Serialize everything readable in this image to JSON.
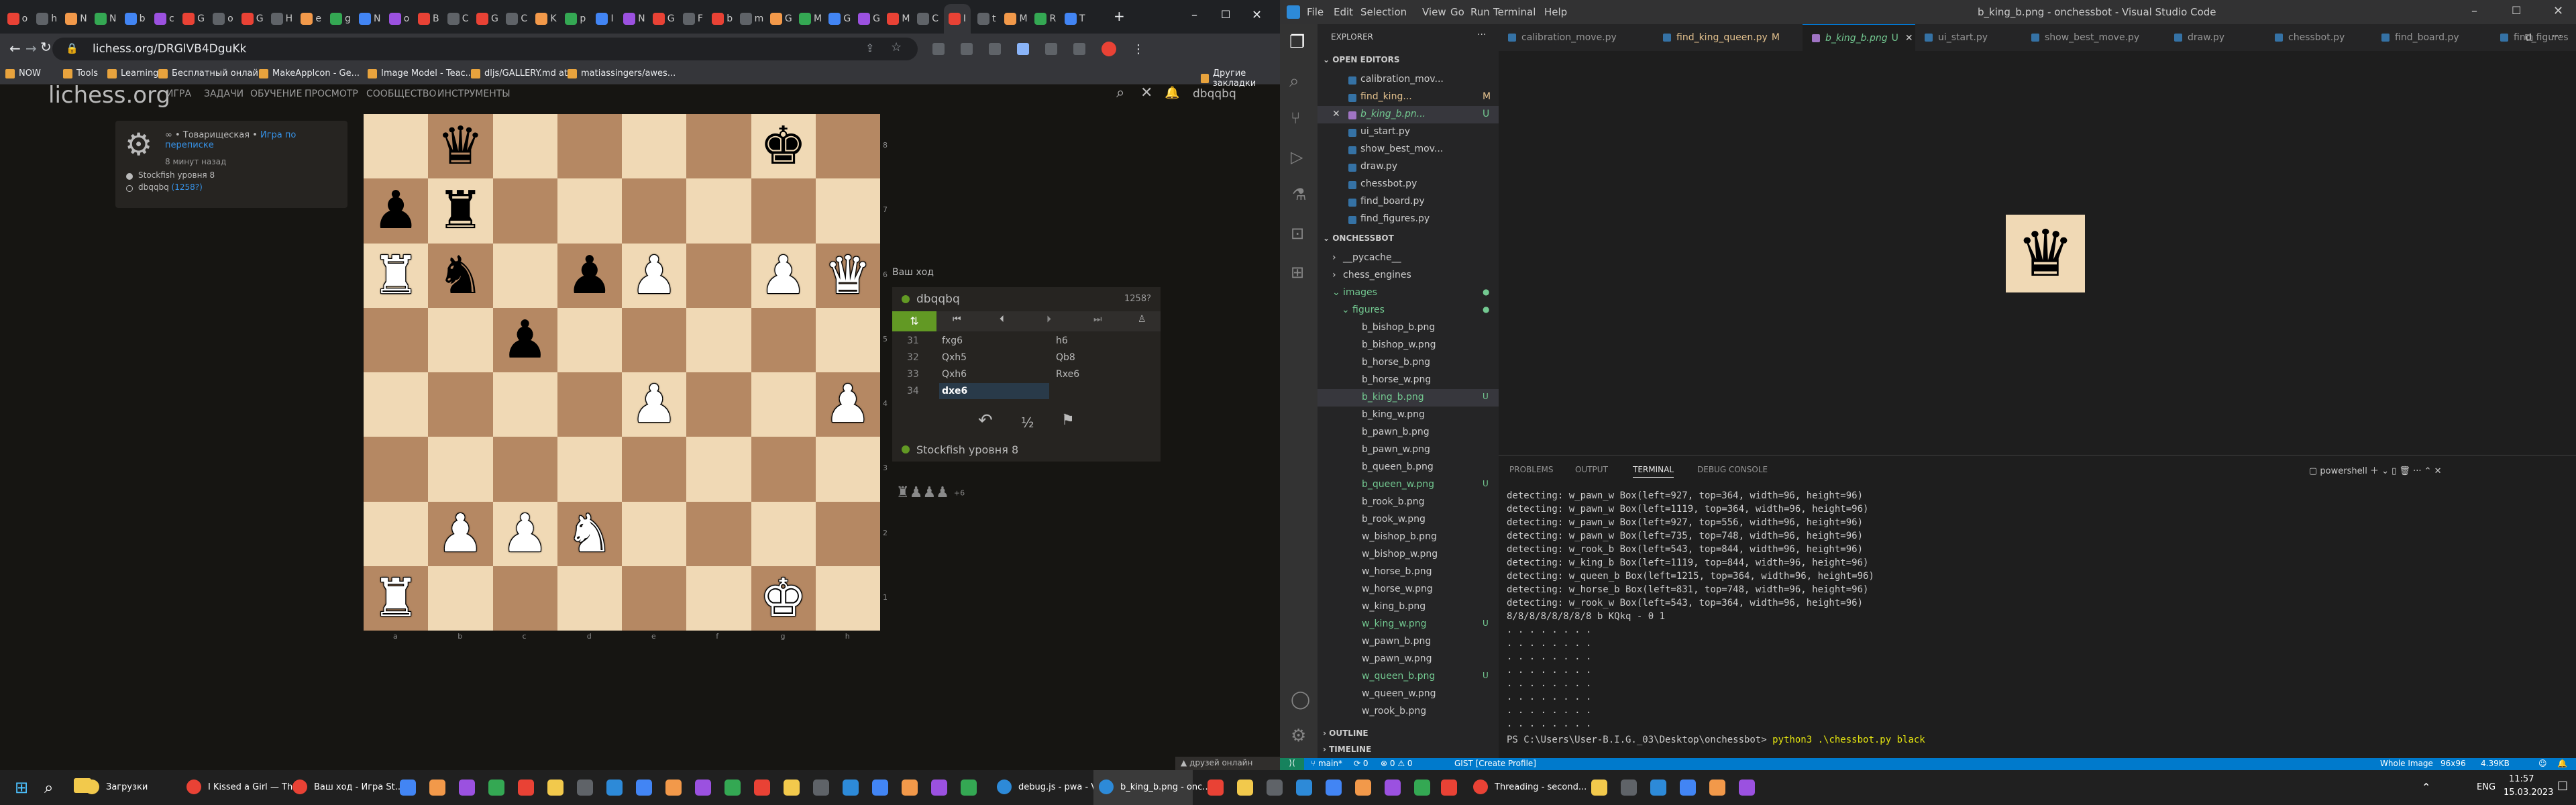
{
  "browser": {
    "url": "lichess.org/DRGlVB4DguKk",
    "tab_labels": [
      "o",
      "h",
      "N",
      "N",
      "b",
      "c",
      "G",
      "o",
      "G",
      "H",
      "e",
      "g",
      "N",
      "o",
      "B",
      "C",
      "G",
      "C",
      "K",
      "p",
      "I",
      "N",
      "G",
      "F",
      "b",
      "m",
      "G",
      "M",
      "G",
      "G",
      "M",
      "C",
      "I",
      "t",
      "M",
      "R",
      "T"
    ],
    "bookmarks": [
      "NOW",
      "Tools",
      "Learning",
      "Бесплатный онлайн",
      "MakeApplcon - Ge...",
      "Image Model - Teac...",
      "dljs/GALLERY.md at...",
      "matiassingers/awes..."
    ],
    "other_bookmarks": "Другие закладки"
  },
  "lichess": {
    "logo": "lichess.org",
    "nav": [
      "ИГРА",
      "ЗАДАЧИ",
      "ОБУЧЕНИЕ",
      "ПРОСМОТР",
      "СООБЩЕСТВО",
      "ИНСТРУМЕНТЫ"
    ],
    "user": "dbqqbq",
    "game": {
      "type": "∞ • Товарищеская •",
      "link": "Игра по переписке",
      "time": "8 минут назад",
      "player_white": "Stockfish уровня 8",
      "player_black": "dbqqbq",
      "player_black_rating": "(1258?)"
    },
    "your_move": "Ваш ход",
    "panel": {
      "player_top": "dbqqbq",
      "rating_top": "1258?",
      "player_bottom": "Stockfish уровня 8",
      "moves": [
        {
          "n": "31",
          "w": "fxg6",
          "b": "h6"
        },
        {
          "n": "32",
          "w": "Qxh5",
          "b": "Qb8"
        },
        {
          "n": "33",
          "w": "Qxh6",
          "b": "Rxe6"
        },
        {
          "n": "34",
          "w": "dxe6",
          "b": ""
        }
      ],
      "material": "+6"
    },
    "files": [
      "a",
      "b",
      "c",
      "d",
      "e",
      "f",
      "g",
      "h"
    ],
    "ranks": [
      "8",
      "7",
      "6",
      "5",
      "4",
      "3",
      "2",
      "1"
    ],
    "friends": "друзей онлайн"
  },
  "board_position": [
    {
      "sq": "b8",
      "p": "bq"
    },
    {
      "sq": "g8",
      "p": "bk"
    },
    {
      "sq": "a7",
      "p": "bp"
    },
    {
      "sq": "b7",
      "p": "br"
    },
    {
      "sq": "a6",
      "p": "wr"
    },
    {
      "sq": "b6",
      "p": "bn"
    },
    {
      "sq": "d6",
      "p": "bp"
    },
    {
      "sq": "e6",
      "p": "wp"
    },
    {
      "sq": "g6",
      "p": "wp"
    },
    {
      "sq": "h6",
      "p": "wq"
    },
    {
      "sq": "c5",
      "p": "bp"
    },
    {
      "sq": "e4",
      "p": "wp"
    },
    {
      "sq": "h4",
      "p": "wp"
    },
    {
      "sq": "b2",
      "p": "wp"
    },
    {
      "sq": "c2",
      "p": "wp"
    },
    {
      "sq": "d2",
      "p": "wn"
    },
    {
      "sq": "a1",
      "p": "wr"
    },
    {
      "sq": "g1",
      "p": "wk"
    }
  ],
  "vscode": {
    "title": "b_king_b.png - onchessbot - Visual Studio Code",
    "menu": [
      "File",
      "Edit",
      "Selection",
      "View",
      "Go",
      "Run",
      "Terminal",
      "Help"
    ],
    "explorer_label": "EXPLORER",
    "open_editors_label": "OPEN EDITORS",
    "open_editors": [
      {
        "name": "calibration_mov...",
        "badge": ""
      },
      {
        "name": "find_king...",
        "badge": "M"
      },
      {
        "name": "b_king_b.pn...",
        "badge": "U"
      },
      {
        "name": "ui_start.py",
        "badge": ""
      },
      {
        "name": "show_best_mov...",
        "badge": ""
      },
      {
        "name": "draw.py",
        "badge": ""
      },
      {
        "name": "chessbot.py",
        "badge": ""
      },
      {
        "name": "find_board.py",
        "badge": ""
      },
      {
        "name": "find_figures.py",
        "badge": ""
      }
    ],
    "project_label": "ONCHESSBOT",
    "tree": [
      {
        "name": "__pycache__",
        "indent": 1,
        "color": "#cccccc",
        "badge": ""
      },
      {
        "name": "chess_engines",
        "indent": 1,
        "color": "#cccccc",
        "badge": ""
      },
      {
        "name": "images",
        "indent": 1,
        "color": "#73c991",
        "badge": "●"
      },
      {
        "name": "figures",
        "indent": 2,
        "color": "#73c991",
        "badge": "●"
      },
      {
        "name": "b_bishop_b.png",
        "indent": 3,
        "color": "#cccccc",
        "badge": ""
      },
      {
        "name": "b_bishop_w.png",
        "indent": 3,
        "color": "#cccccc",
        "badge": ""
      },
      {
        "name": "b_horse_b.png",
        "indent": 3,
        "color": "#cccccc",
        "badge": ""
      },
      {
        "name": "b_horse_w.png",
        "indent": 3,
        "color": "#cccccc",
        "badge": ""
      },
      {
        "name": "b_king_b.png",
        "indent": 3,
        "color": "#73c991",
        "badge": "U"
      },
      {
        "name": "b_king_w.png",
        "indent": 3,
        "color": "#cccccc",
        "badge": ""
      },
      {
        "name": "b_pawn_b.png",
        "indent": 3,
        "color": "#cccccc",
        "badge": ""
      },
      {
        "name": "b_pawn_w.png",
        "indent": 3,
        "color": "#cccccc",
        "badge": ""
      },
      {
        "name": "b_queen_b.png",
        "indent": 3,
        "color": "#cccccc",
        "badge": ""
      },
      {
        "name": "b_queen_w.png",
        "indent": 3,
        "color": "#73c991",
        "badge": "U"
      },
      {
        "name": "b_rook_b.png",
        "indent": 3,
        "color": "#cccccc",
        "badge": ""
      },
      {
        "name": "b_rook_w.png",
        "indent": 3,
        "color": "#cccccc",
        "badge": ""
      },
      {
        "name": "w_bishop_b.png",
        "indent": 3,
        "color": "#cccccc",
        "badge": ""
      },
      {
        "name": "w_bishop_w.png",
        "indent": 3,
        "color": "#cccccc",
        "badge": ""
      },
      {
        "name": "w_horse_b.png",
        "indent": 3,
        "color": "#cccccc",
        "badge": ""
      },
      {
        "name": "w_horse_w.png",
        "indent": 3,
        "color": "#cccccc",
        "badge": ""
      },
      {
        "name": "w_king_b.png",
        "indent": 3,
        "color": "#cccccc",
        "badge": ""
      },
      {
        "name": "w_king_w.png",
        "indent": 3,
        "color": "#73c991",
        "badge": "U"
      },
      {
        "name": "w_pawn_b.png",
        "indent": 3,
        "color": "#cccccc",
        "badge": ""
      },
      {
        "name": "w_pawn_w.png",
        "indent": 3,
        "color": "#cccccc",
        "badge": ""
      },
      {
        "name": "w_queen_b.png",
        "indent": 3,
        "color": "#73c991",
        "badge": "U"
      },
      {
        "name": "w_queen_w.png",
        "indent": 3,
        "color": "#cccccc",
        "badge": ""
      },
      {
        "name": "w_rook_b.png",
        "indent": 3,
        "color": "#cccccc",
        "badge": ""
      }
    ],
    "outline_label": "OUTLINE",
    "timeline_label": "TIMELINE",
    "tabs": [
      {
        "name": "calibration_move.py",
        "color": "#969696",
        "active": false
      },
      {
        "name": "find_king_queen.py",
        "color": "#e2c08d",
        "badge": "M",
        "active": false
      },
      {
        "name": "b_king_b.png",
        "color": "#73c991",
        "badge": "U",
        "active": true
      },
      {
        "name": "ui_start.py",
        "color": "#969696",
        "active": false
      },
      {
        "name": "show_best_move.py",
        "color": "#969696",
        "active": false
      },
      {
        "name": "draw.py",
        "color": "#969696",
        "active": false
      },
      {
        "name": "chessbot.py",
        "color": "#969696",
        "active": false
      },
      {
        "name": "find_board.py",
        "color": "#969696",
        "active": false
      },
      {
        "name": "find_figures",
        "color": "#969696",
        "active": false
      }
    ],
    "panel_tabs": [
      "PROBLEMS",
      "OUTPUT",
      "TERMINAL",
      "DEBUG CONSOLE"
    ],
    "shell": "powershell",
    "terminal_lines": [
      "detecting: w_pawn_w Box(left=927, top=364, width=96, height=96)",
      "detecting: w_pawn_w Box(left=1119, top=364, width=96, height=96)",
      "detecting: w_pawn_w Box(left=927, top=556, width=96, height=96)",
      "detecting: w_pawn_w Box(left=735, top=748, width=96, height=96)",
      "detecting: w_rook_b Box(left=543, top=844, width=96, height=96)",
      "detecting: w_king_b Box(left=1119, top=844, width=96, height=96)",
      "detecting: w_queen_b Box(left=1215, top=364, width=96, height=96)",
      "detecting: w_horse_b Box(left=831, top=748, width=96, height=96)",
      "detecting: w_rook_w Box(left=543, top=364, width=96, height=96)",
      "8/8/8/8/8/8/8/8 b KQkq - 0 1",
      ". . . . . . . .",
      ". . . . . . . .",
      ". . . . . . . .",
      ". . . . . . . .",
      ". . . . . . . .",
      ". . . . . . . .",
      ". . . . . . . .",
      ". . . . . . . ."
    ],
    "prompt": "PS C:\\Users\\User-B.I.G._03\\Desktop\\onchessbot> ",
    "command": "python3 .\\chessbot.py black",
    "status": {
      "branch": "main*",
      "errors": "⊗ 0 ⚠ 0",
      "sync": "⟳ 0",
      "gist": "GIST [Create Profile]",
      "right_type": "Whole Image",
      "right_dims": "96x96",
      "right_size": "4.39KB"
    }
  },
  "taskbar": {
    "items": [
      "Загрузки",
      "I Kissed a Girl — Th...",
      "Ваш ход - Игра St...",
      "debug.js - pwa - Vi...",
      "b_king_b.png - onc...",
      "Threading - second..."
    ],
    "lang": "ENG",
    "time": "11:57",
    "date": "15.03.2023"
  }
}
